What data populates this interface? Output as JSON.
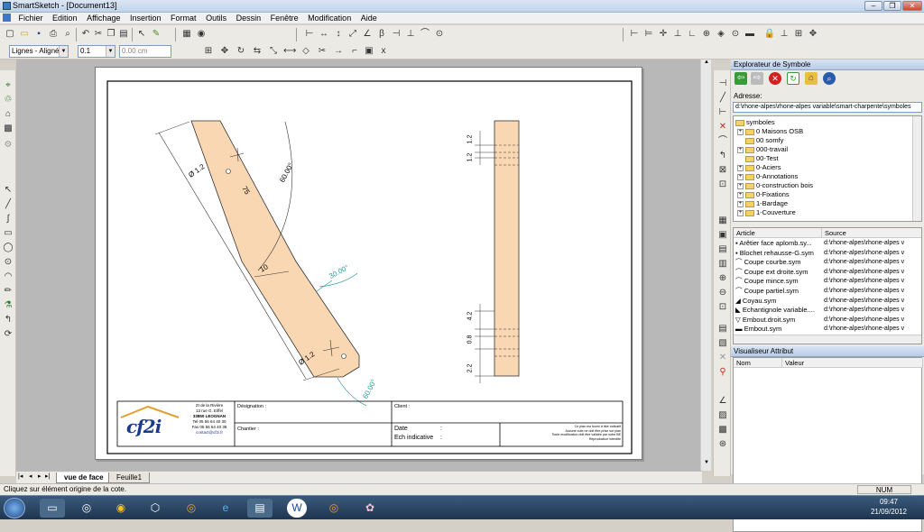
{
  "title": "SmartSketch - [Document13]",
  "window_controls": {
    "minimize": "–",
    "restore": "❐",
    "close": "✕"
  },
  "menu": [
    "Fichier",
    "Edition",
    "Affichage",
    "Insertion",
    "Format",
    "Outils",
    "Dessin",
    "Fenêtre",
    "Modification",
    "Aide"
  ],
  "toolbar2": {
    "line_style": "Lignes - Alignée",
    "line_width": "0.1",
    "length_value": "0.00 cm",
    "close_label": "x"
  },
  "explorer": {
    "title": "Explorateur de Symbole",
    "address_label": "Adresse:",
    "address": "d:\\rhone-alpes\\rhone-alpes variable\\smart-charpente\\symboles",
    "tree": [
      "symboles",
      "0 Maisons OSB",
      "00 somfy",
      "000-travail",
      "00-Test",
      "0-Aciers",
      "0-Annotations",
      "0-construction bois",
      "0-Fixations",
      "1-Bardage",
      "1-Couverture"
    ],
    "list_headers": {
      "article": "Article",
      "source": "Source"
    },
    "list_rows": [
      {
        "article": "Arêtier face aplomb.sy...",
        "source": "d:\\rhone-alpes\\rhone-alpes v"
      },
      {
        "article": "Blochet rehausse-G.sym",
        "source": "d:\\rhone-alpes\\rhone-alpes v"
      },
      {
        "article": "Coupe courbe.sym",
        "source": "d:\\rhone-alpes\\rhone-alpes v"
      },
      {
        "article": "Coupe ext droite.sym",
        "source": "d:\\rhone-alpes\\rhone-alpes v"
      },
      {
        "article": "Coupe mince.sym",
        "source": "d:\\rhone-alpes\\rhone-alpes v"
      },
      {
        "article": "Coupe partiel.sym",
        "source": "d:\\rhone-alpes\\rhone-alpes v"
      },
      {
        "article": "Coyau.sym",
        "source": "d:\\rhone-alpes\\rhone-alpes v"
      },
      {
        "article": "Echantignole variable....",
        "source": "d:\\rhone-alpes\\rhone-alpes v"
      },
      {
        "article": "Embout.droit.sym",
        "source": "d:\\rhone-alpes\\rhone-alpes v"
      },
      {
        "article": "Embout.sym",
        "source": "d:\\rhone-alpes\\rhone-alpes v"
      }
    ],
    "attr_title": "Visualiseur Attribut",
    "attr_headers": {
      "name": "Nom",
      "value": "Valeur"
    }
  },
  "drawing": {
    "dim_length": "75",
    "dim_width": "10",
    "dim_diam_top": "Ø 1.2",
    "dim_diam_bottom": "Ø 1.2",
    "angle_top": "60.00°",
    "angle_mid": "30.00°",
    "angle_bottom": "60.00°",
    "side_dim_1": "1.2",
    "side_dim_2": "1.2",
    "side_dim_3": "4.2",
    "side_dim_4": "0.8",
    "side_dim_5": "2.2"
  },
  "title_block": {
    "company_lines": [
      "ZI de la Rivière",
      "13 rue G. Eiffel",
      "33850 LEOGNAN",
      "Tel 05 56 64 40 30",
      "Fax 05 56 64 40 38",
      "contact@cf2i.fr"
    ],
    "logo_text": "cf2i",
    "designation": "Désignation :",
    "chantier": "Chantier :",
    "client": "Client :",
    "date": "Date",
    "ech": "Ech indicative",
    "colon": ":",
    "notice_lines": [
      "Ce plan est fourni à titre indicatif",
      "Aucune cote ne doit être prise sur plan",
      "Toute modification doit être validée par notre BE",
      "Reproduction interdite"
    ]
  },
  "tabs": [
    "vue de face",
    "Feuille1"
  ],
  "status": {
    "message": "Cliquez sur élément origine de la cote.",
    "num": "NUM"
  },
  "clock": {
    "time": "09:47",
    "date": "21/09/2012"
  },
  "colors": {
    "wood": "#f9d7b3",
    "dim_green": "#2a9d9a",
    "dim_dark": "#333333"
  }
}
